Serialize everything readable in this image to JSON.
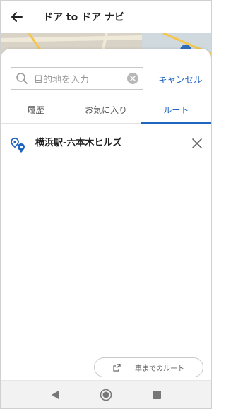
{
  "header": {
    "title": "ドア to ドア ナビ"
  },
  "search": {
    "placeholder": "目的地を入力",
    "cancel_label": "キャンセル"
  },
  "tabs": [
    {
      "label": "履歴",
      "active": false
    },
    {
      "label": "お気に入り",
      "active": false
    },
    {
      "label": "ルート",
      "active": true
    }
  ],
  "routes": [
    {
      "label": "横浜駅-六本木ヒルズ"
    }
  ],
  "footer": {
    "car_route_label": "車までのルート"
  },
  "colors": {
    "accent": "#1f66c1",
    "text": "#222222",
    "muted": "#9a9a9a",
    "map": "#d9d3c7"
  },
  "icons": [
    "back-arrow-icon",
    "search-icon",
    "clear-icon",
    "route-pin-icon",
    "close-icon",
    "external-link-icon",
    "nav-back-icon",
    "nav-home-icon",
    "nav-recent-icon"
  ]
}
